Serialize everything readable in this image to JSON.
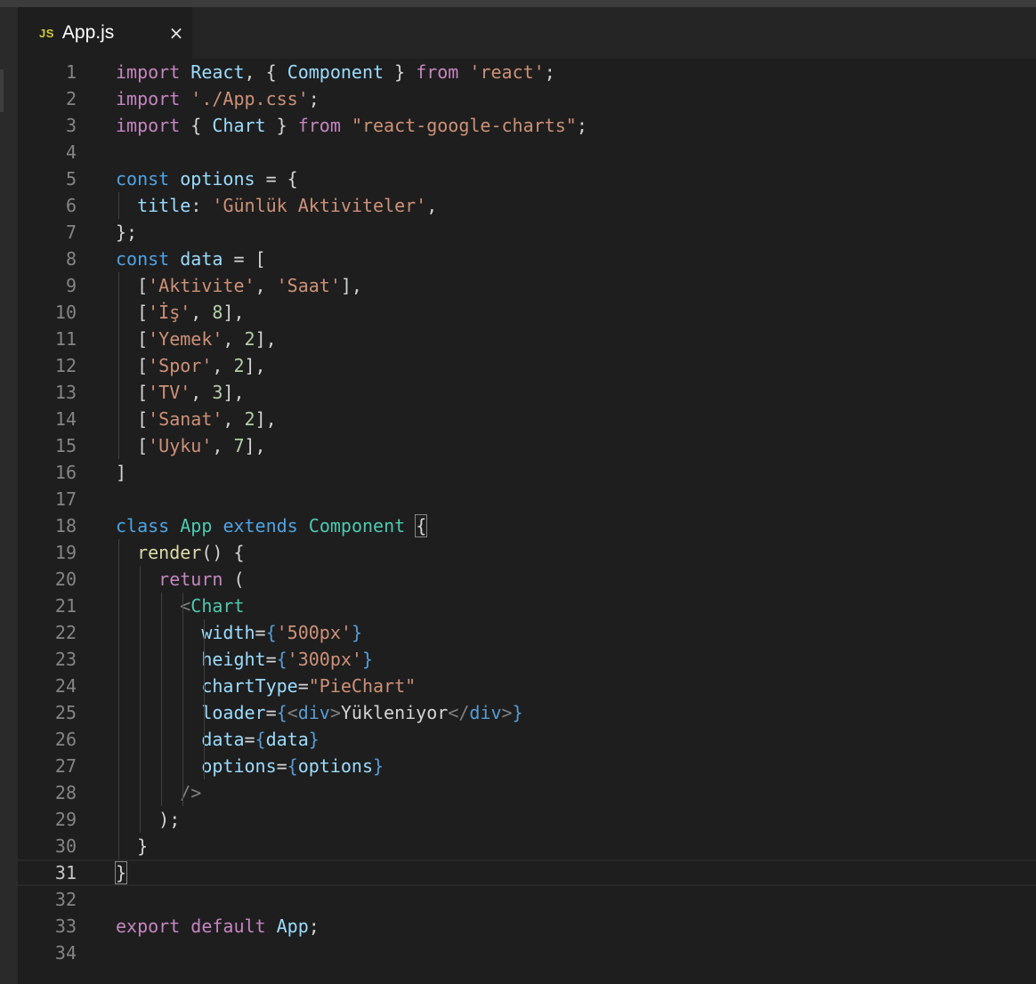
{
  "window": {
    "accent": "#cbcb41",
    "background": "#1e1e1e"
  },
  "tab": {
    "icon_label": "JS",
    "filename": "App.js",
    "close_glyph": "×",
    "icon": "javascript-file-icon"
  },
  "editor": {
    "current_line": 31,
    "lines": [
      {
        "n": 1,
        "tokens": [
          [
            "kw",
            "import"
          ],
          [
            "txt",
            " "
          ],
          [
            "pr",
            "React"
          ],
          [
            "txt",
            ", { "
          ],
          [
            "pr",
            "Component"
          ],
          [
            "txt",
            " } "
          ],
          [
            "kw",
            "from"
          ],
          [
            "txt",
            " "
          ],
          [
            "str",
            "'react'"
          ],
          [
            "txt",
            ";"
          ]
        ]
      },
      {
        "n": 2,
        "tokens": [
          [
            "kw",
            "import"
          ],
          [
            "txt",
            " "
          ],
          [
            "str",
            "'./App.css'"
          ],
          [
            "txt",
            ";"
          ]
        ]
      },
      {
        "n": 3,
        "tokens": [
          [
            "kw",
            "import"
          ],
          [
            "txt",
            " { "
          ],
          [
            "pr",
            "Chart"
          ],
          [
            "txt",
            " } "
          ],
          [
            "kw",
            "from"
          ],
          [
            "txt",
            " "
          ],
          [
            "str",
            "\"react-google-charts\""
          ],
          [
            "txt",
            ";"
          ]
        ]
      },
      {
        "n": 4,
        "tokens": []
      },
      {
        "n": 5,
        "tokens": [
          [
            "st",
            "const"
          ],
          [
            "txt",
            " "
          ],
          [
            "pr",
            "options"
          ],
          [
            "txt",
            " = {"
          ]
        ]
      },
      {
        "n": 6,
        "tokens": [
          [
            "txt",
            "  "
          ],
          [
            "pr",
            "title"
          ],
          [
            "txt",
            ": "
          ],
          [
            "str",
            "'Günlük Aktiviteler'"
          ],
          [
            "txt",
            ","
          ]
        ]
      },
      {
        "n": 7,
        "tokens": [
          [
            "txt",
            "};"
          ]
        ]
      },
      {
        "n": 8,
        "tokens": [
          [
            "st",
            "const"
          ],
          [
            "txt",
            " "
          ],
          [
            "pr",
            "data"
          ],
          [
            "txt",
            " = ["
          ]
        ]
      },
      {
        "n": 9,
        "tokens": [
          [
            "txt",
            "  ["
          ],
          [
            "str",
            "'Aktivite'"
          ],
          [
            "txt",
            ", "
          ],
          [
            "str",
            "'Saat'"
          ],
          [
            "txt",
            "],"
          ]
        ]
      },
      {
        "n": 10,
        "tokens": [
          [
            "txt",
            "  ["
          ],
          [
            "str",
            "'İş'"
          ],
          [
            "txt",
            ", "
          ],
          [
            "num",
            "8"
          ],
          [
            "txt",
            "],"
          ]
        ]
      },
      {
        "n": 11,
        "tokens": [
          [
            "txt",
            "  ["
          ],
          [
            "str",
            "'Yemek'"
          ],
          [
            "txt",
            ", "
          ],
          [
            "num",
            "2"
          ],
          [
            "txt",
            "],"
          ]
        ]
      },
      {
        "n": 12,
        "tokens": [
          [
            "txt",
            "  ["
          ],
          [
            "str",
            "'Spor'"
          ],
          [
            "txt",
            ", "
          ],
          [
            "num",
            "2"
          ],
          [
            "txt",
            "],"
          ]
        ]
      },
      {
        "n": 13,
        "tokens": [
          [
            "txt",
            "  ["
          ],
          [
            "str",
            "'TV'"
          ],
          [
            "txt",
            ", "
          ],
          [
            "num",
            "3"
          ],
          [
            "txt",
            "],"
          ]
        ]
      },
      {
        "n": 14,
        "tokens": [
          [
            "txt",
            "  ["
          ],
          [
            "str",
            "'Sanat'"
          ],
          [
            "txt",
            ", "
          ],
          [
            "num",
            "2"
          ],
          [
            "txt",
            "],"
          ]
        ]
      },
      {
        "n": 15,
        "tokens": [
          [
            "txt",
            "  ["
          ],
          [
            "str",
            "'Uyku'"
          ],
          [
            "txt",
            ", "
          ],
          [
            "num",
            "7"
          ],
          [
            "txt",
            "],"
          ]
        ]
      },
      {
        "n": 16,
        "tokens": [
          [
            "txt",
            "]"
          ]
        ]
      },
      {
        "n": 17,
        "tokens": []
      },
      {
        "n": 18,
        "tokens": [
          [
            "st",
            "class"
          ],
          [
            "txt",
            " "
          ],
          [
            "cls",
            "App"
          ],
          [
            "txt",
            " "
          ],
          [
            "st",
            "extends"
          ],
          [
            "txt",
            " "
          ],
          [
            "cls",
            "Component"
          ],
          [
            "txt",
            " "
          ],
          [
            "box",
            "{"
          ]
        ]
      },
      {
        "n": 19,
        "tokens": [
          [
            "txt",
            "  "
          ],
          [
            "fn",
            "render"
          ],
          [
            "txt",
            "() {"
          ]
        ]
      },
      {
        "n": 20,
        "tokens": [
          [
            "txt",
            "    "
          ],
          [
            "kw",
            "return"
          ],
          [
            "txt",
            " ("
          ]
        ]
      },
      {
        "n": 21,
        "tokens": [
          [
            "txt",
            "      "
          ],
          [
            "tg",
            "<"
          ],
          [
            "cls",
            "Chart"
          ]
        ]
      },
      {
        "n": 22,
        "tokens": [
          [
            "txt",
            "        "
          ],
          [
            "pr",
            "width"
          ],
          [
            "txt",
            "="
          ],
          [
            "jsx",
            "{"
          ],
          [
            "str",
            "'500px'"
          ],
          [
            "jsx",
            "}"
          ]
        ]
      },
      {
        "n": 23,
        "tokens": [
          [
            "txt",
            "        "
          ],
          [
            "pr",
            "height"
          ],
          [
            "txt",
            "="
          ],
          [
            "jsx",
            "{"
          ],
          [
            "str",
            "'300px'"
          ],
          [
            "jsx",
            "}"
          ]
        ]
      },
      {
        "n": 24,
        "tokens": [
          [
            "txt",
            "        "
          ],
          [
            "pr",
            "chartType"
          ],
          [
            "txt",
            "="
          ],
          [
            "str",
            "\"PieChart\""
          ]
        ]
      },
      {
        "n": 25,
        "tokens": [
          [
            "txt",
            "        "
          ],
          [
            "pr",
            "loader"
          ],
          [
            "txt",
            "="
          ],
          [
            "jsx",
            "{"
          ],
          [
            "tg",
            "<"
          ],
          [
            "jsx",
            "div"
          ],
          [
            "tg",
            ">"
          ],
          [
            "txt",
            "Yükleniyor"
          ],
          [
            "tg",
            "</"
          ],
          [
            "jsx",
            "div"
          ],
          [
            "tg",
            ">"
          ],
          [
            "jsx",
            "}"
          ]
        ]
      },
      {
        "n": 26,
        "tokens": [
          [
            "txt",
            "        "
          ],
          [
            "pr",
            "data"
          ],
          [
            "txt",
            "="
          ],
          [
            "jsx",
            "{"
          ],
          [
            "pr",
            "data"
          ],
          [
            "jsx",
            "}"
          ]
        ]
      },
      {
        "n": 27,
        "tokens": [
          [
            "txt",
            "        "
          ],
          [
            "pr",
            "options"
          ],
          [
            "txt",
            "="
          ],
          [
            "jsx",
            "{"
          ],
          [
            "pr",
            "options"
          ],
          [
            "jsx",
            "}"
          ]
        ]
      },
      {
        "n": 28,
        "tokens": [
          [
            "txt",
            "      "
          ],
          [
            "tg",
            "/>"
          ]
        ]
      },
      {
        "n": 29,
        "tokens": [
          [
            "txt",
            "    );"
          ]
        ]
      },
      {
        "n": 30,
        "tokens": [
          [
            "txt",
            "  }"
          ]
        ]
      },
      {
        "n": 31,
        "tokens": [
          [
            "box",
            "}"
          ]
        ]
      },
      {
        "n": 32,
        "tokens": []
      },
      {
        "n": 33,
        "tokens": [
          [
            "kw",
            "export"
          ],
          [
            "txt",
            " "
          ],
          [
            "kw",
            "default"
          ],
          [
            "txt",
            " "
          ],
          [
            "pr",
            "App"
          ],
          [
            "txt",
            ";"
          ]
        ]
      },
      {
        "n": 34,
        "tokens": []
      }
    ]
  }
}
